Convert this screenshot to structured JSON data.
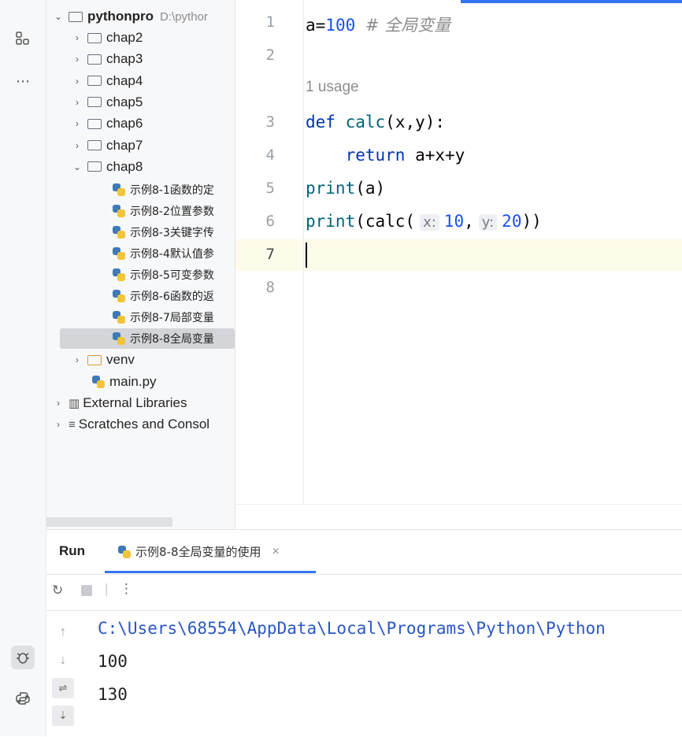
{
  "tree": {
    "root": {
      "name": "pythonpro",
      "path": "D:\\pythor"
    },
    "folders": [
      "chap2",
      "chap3",
      "chap4",
      "chap5",
      "chap6",
      "chap7",
      "chap8"
    ],
    "chap8_files": [
      "示例8-1函数的定",
      "示例8-2位置参数",
      "示例8-3关键字传",
      "示例8-4默认值参",
      "示例8-5可变参数",
      "示例8-6函数的返",
      "示例8-7局部变量",
      "示例8-8全局变量"
    ],
    "venv": "venv",
    "main": "main.py",
    "external": "External Libraries",
    "scratches": "Scratches and Consol"
  },
  "editor": {
    "line_numbers": [
      "1",
      "2",
      "3",
      "4",
      "5",
      "6",
      "7",
      "8"
    ],
    "usage_hint": "1 usage",
    "line1": {
      "var": "a=",
      "num": "100",
      "comment": "# 全局变量"
    },
    "line3": {
      "kw": "def",
      "fn": "calc",
      "rest": "(x,y):"
    },
    "line4": {
      "kw": "return",
      "rest": "a+x+y"
    },
    "line5": {
      "fn": "print",
      "rest": "(a)"
    },
    "line6": {
      "fn": "print",
      "mid": "(calc(",
      "hint_x": "x:",
      "num_x": "10",
      "comma": ",",
      "hint_y": "y:",
      "num_y": "20",
      "end": "))"
    }
  },
  "run": {
    "title": "Run",
    "tab_label": "示例8-8全局变量的使用",
    "output": [
      "C:\\Users\\68554\\AppData\\Local\\Programs\\Python\\Python",
      "100",
      "130"
    ]
  }
}
